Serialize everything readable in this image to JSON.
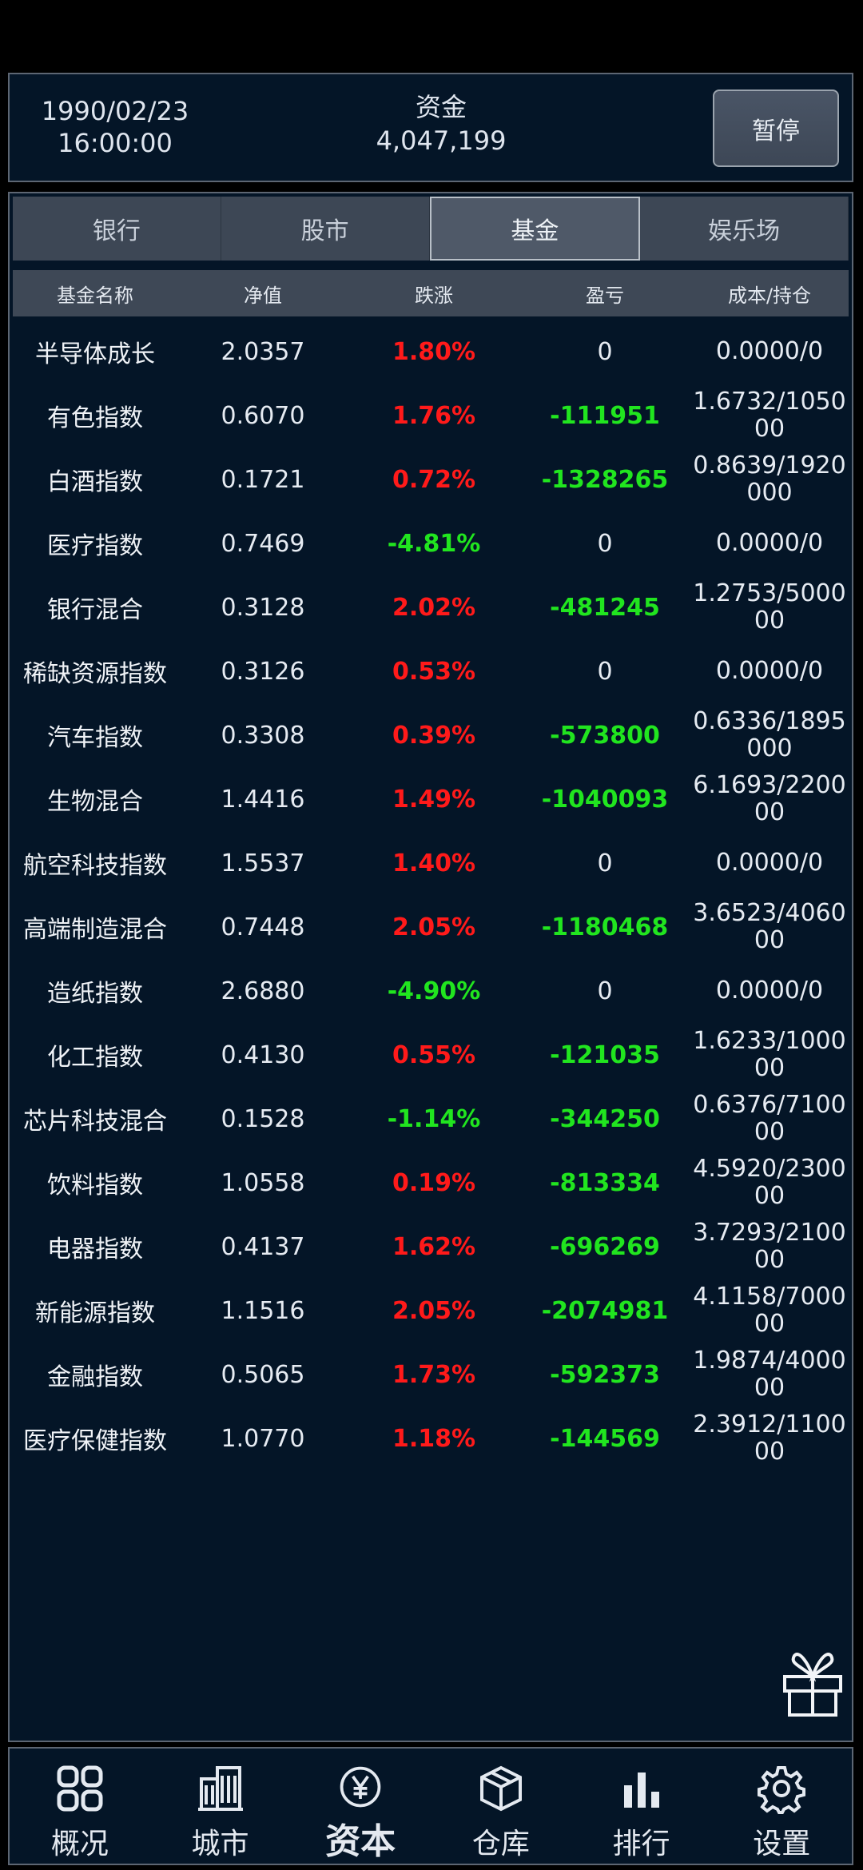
{
  "header": {
    "date": "1990/02/23",
    "time": "16:00:00",
    "funds_label": "资金",
    "funds_value": "4,047,199",
    "pause_label": "暂停"
  },
  "tabs": [
    {
      "label": "银行",
      "active": false
    },
    {
      "label": "股市",
      "active": false
    },
    {
      "label": "基金",
      "active": true
    },
    {
      "label": "娱乐场",
      "active": false
    }
  ],
  "table": {
    "headers": [
      "基金名称",
      "净值",
      "跌涨",
      "盈亏",
      "成本/持仓"
    ],
    "rows": [
      {
        "name": "半导体成长",
        "nav": "2.0357",
        "change": "1.80%",
        "dir": "up",
        "pnl": "0",
        "cost": "0.0000/0"
      },
      {
        "name": "有色指数",
        "nav": "0.6070",
        "change": "1.76%",
        "dir": "up",
        "pnl": "-111951",
        "cost": "1.6732/105000"
      },
      {
        "name": "白酒指数",
        "nav": "0.1721",
        "change": "0.72%",
        "dir": "up",
        "pnl": "-1328265",
        "cost": "0.8639/1920000"
      },
      {
        "name": "医疗指数",
        "nav": "0.7469",
        "change": "-4.81%",
        "dir": "down",
        "pnl": "0",
        "cost": "0.0000/0"
      },
      {
        "name": "银行混合",
        "nav": "0.3128",
        "change": "2.02%",
        "dir": "up",
        "pnl": "-481245",
        "cost": "1.2753/500000"
      },
      {
        "name": "稀缺资源指数",
        "nav": "0.3126",
        "change": "0.53%",
        "dir": "up",
        "pnl": "0",
        "cost": "0.0000/0"
      },
      {
        "name": "汽车指数",
        "nav": "0.3308",
        "change": "0.39%",
        "dir": "up",
        "pnl": "-573800",
        "cost": "0.6336/1895000"
      },
      {
        "name": "生物混合",
        "nav": "1.4416",
        "change": "1.49%",
        "dir": "up",
        "pnl": "-1040093",
        "cost": "6.1693/220000"
      },
      {
        "name": "航空科技指数",
        "nav": "1.5537",
        "change": "1.40%",
        "dir": "up",
        "pnl": "0",
        "cost": "0.0000/0"
      },
      {
        "name": "高端制造混合",
        "nav": "0.7448",
        "change": "2.05%",
        "dir": "up",
        "pnl": "-1180468",
        "cost": "3.6523/406000"
      },
      {
        "name": "造纸指数",
        "nav": "2.6880",
        "change": "-4.90%",
        "dir": "down",
        "pnl": "0",
        "cost": "0.0000/0"
      },
      {
        "name": "化工指数",
        "nav": "0.4130",
        "change": "0.55%",
        "dir": "up",
        "pnl": "-121035",
        "cost": "1.6233/100000"
      },
      {
        "name": "芯片科技混合",
        "nav": "0.1528",
        "change": "-1.14%",
        "dir": "down",
        "pnl": "-344250",
        "cost": "0.6376/710000"
      },
      {
        "name": "饮料指数",
        "nav": "1.0558",
        "change": "0.19%",
        "dir": "up",
        "pnl": "-813334",
        "cost": "4.5920/230000"
      },
      {
        "name": "电器指数",
        "nav": "0.4137",
        "change": "1.62%",
        "dir": "up",
        "pnl": "-696269",
        "cost": "3.7293/210000"
      },
      {
        "name": "新能源指数",
        "nav": "1.1516",
        "change": "2.05%",
        "dir": "up",
        "pnl": "-2074981",
        "cost": "4.1158/700000"
      },
      {
        "name": "金融指数",
        "nav": "0.5065",
        "change": "1.73%",
        "dir": "up",
        "pnl": "-592373",
        "cost": "1.9874/400000"
      },
      {
        "name": "医疗保健指数",
        "nav": "1.0770",
        "change": "1.18%",
        "dir": "up",
        "pnl": "-144569",
        "cost": "2.3912/110000"
      }
    ]
  },
  "nav": [
    {
      "label": "概况",
      "icon": "grid-icon",
      "active": false
    },
    {
      "label": "城市",
      "icon": "building-icon",
      "active": false
    },
    {
      "label": "资本",
      "icon": "yen-coin-icon",
      "active": true
    },
    {
      "label": "仓库",
      "icon": "box-icon",
      "active": false
    },
    {
      "label": "排行",
      "icon": "bar-chart-icon",
      "active": false
    },
    {
      "label": "设置",
      "icon": "gear-icon",
      "active": false
    }
  ],
  "colors": {
    "up": "#ff1a1a",
    "down": "#21e51f",
    "panel": "#041527"
  }
}
